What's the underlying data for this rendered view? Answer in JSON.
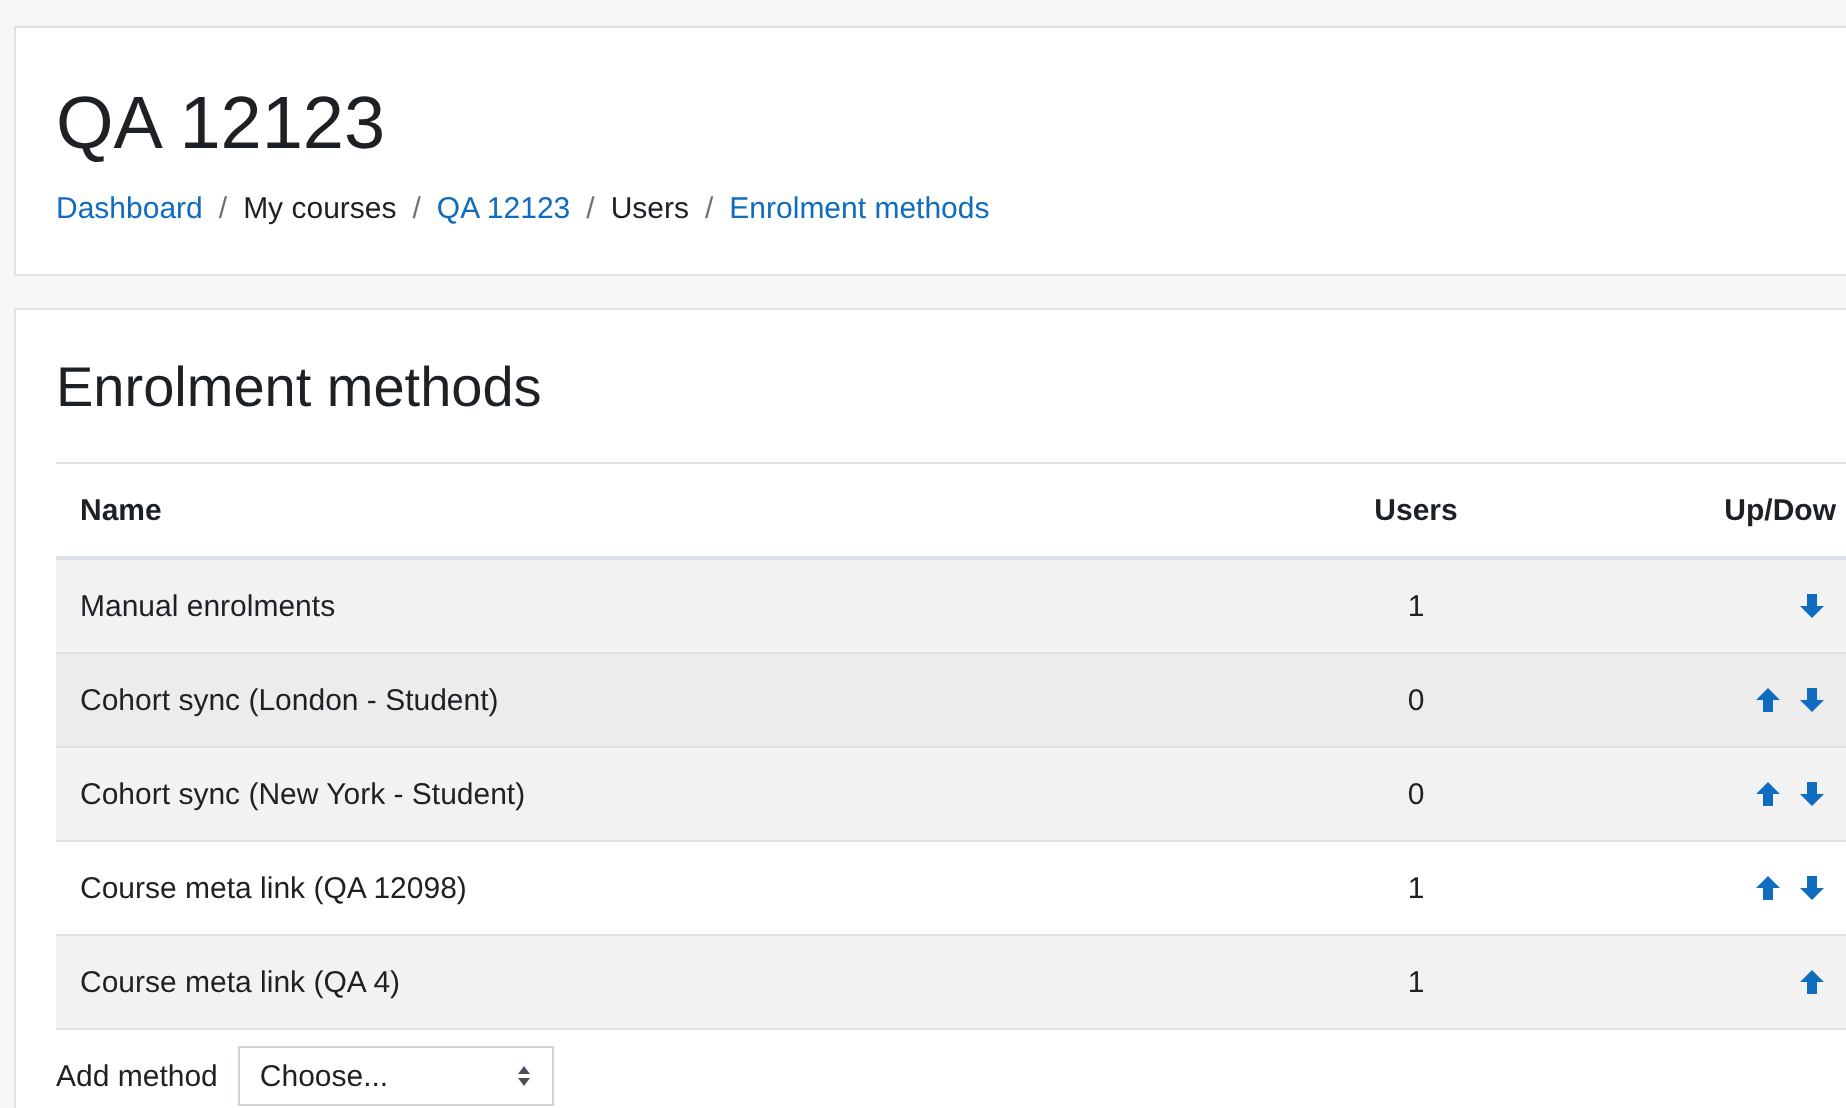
{
  "header": {
    "title": "QA 12123",
    "breadcrumb": [
      {
        "label": "Dashboard",
        "link": true
      },
      {
        "label": "My courses",
        "link": false
      },
      {
        "label": "QA 12123",
        "link": true
      },
      {
        "label": "Users",
        "link": false
      },
      {
        "label": "Enrolment methods",
        "link": true
      }
    ],
    "separator": "/"
  },
  "section": {
    "title": "Enrolment methods"
  },
  "table": {
    "columns": [
      "Name",
      "Users",
      "Up/Dow"
    ],
    "rows": [
      {
        "name": "Manual enrolments",
        "users": "1",
        "up": false,
        "down": true,
        "hovered": false
      },
      {
        "name": "Cohort sync (London - Student)",
        "users": "0",
        "up": true,
        "down": true,
        "hovered": true
      },
      {
        "name": "Cohort sync (New York - Student)",
        "users": "0",
        "up": true,
        "down": true,
        "hovered": false
      },
      {
        "name": "Course meta link (QA 12098)",
        "users": "1",
        "up": true,
        "down": true,
        "hovered": false
      },
      {
        "name": "Course meta link (QA 4)",
        "users": "1",
        "up": true,
        "down": false,
        "hovered": false
      }
    ]
  },
  "add_method": {
    "label": "Add method",
    "select_value": "Choose..."
  }
}
